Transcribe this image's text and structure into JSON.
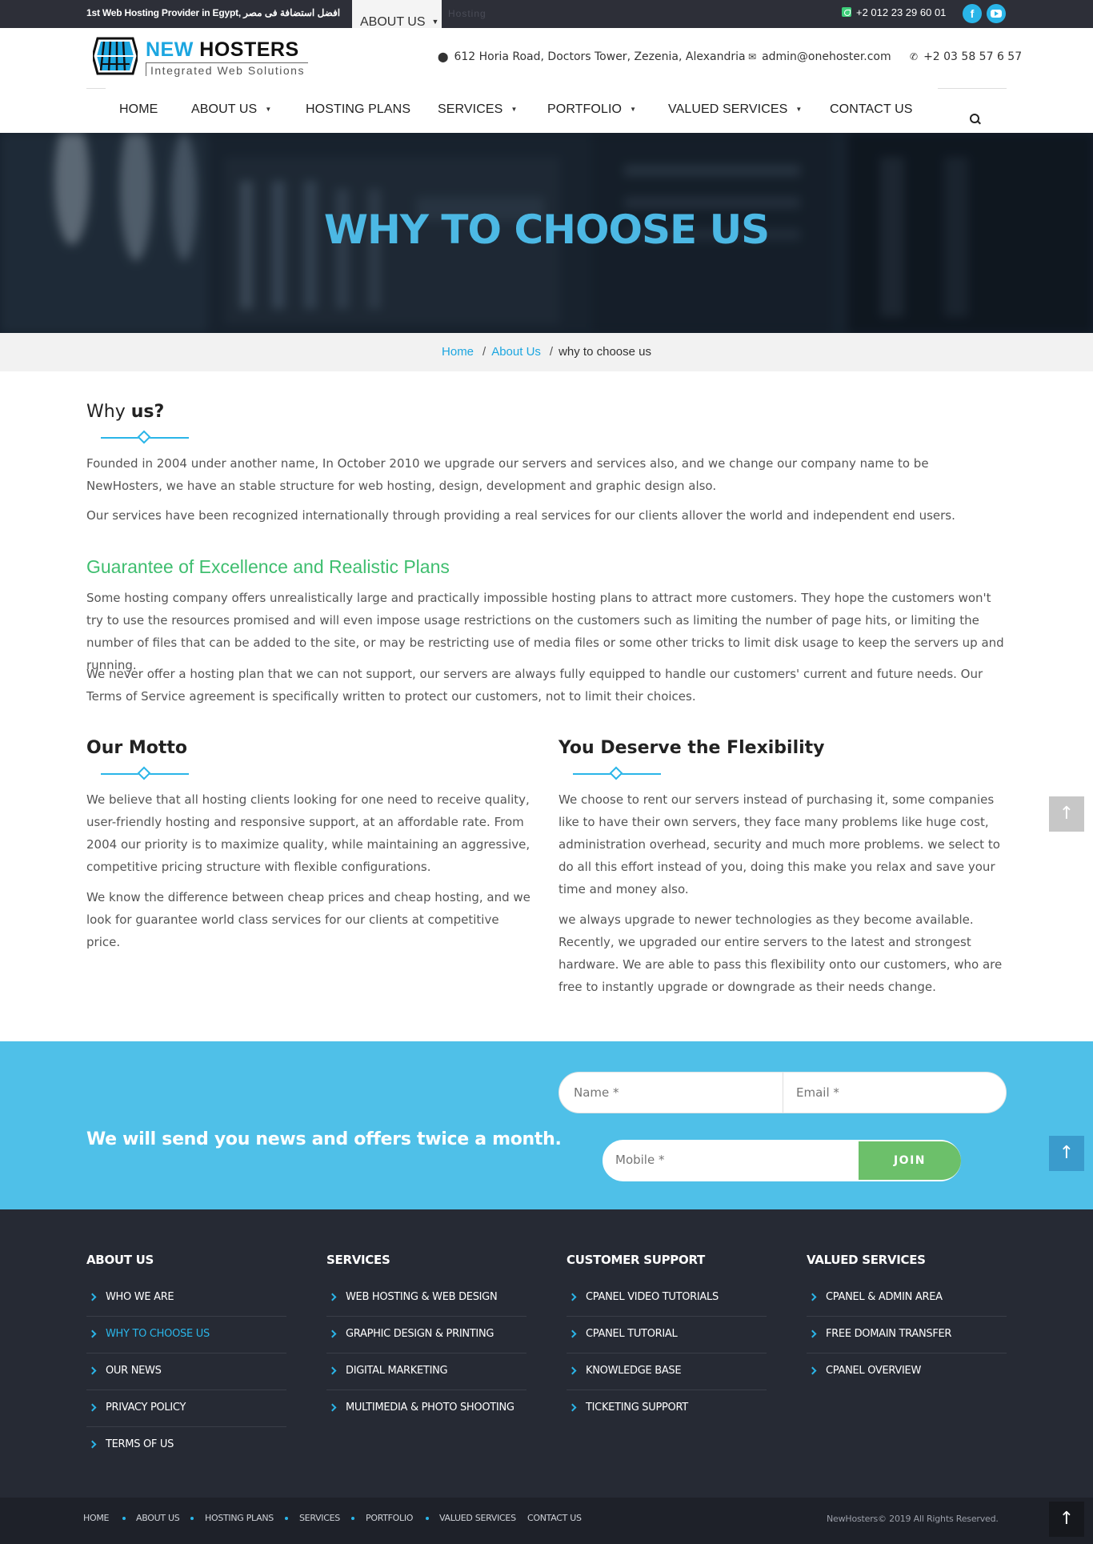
{
  "topbar": {
    "tagline": "1st Web Hosting Provider in Egypt, افضل استضافة فى مصر",
    "ghost_text": "Hosting",
    "dropdown_open": "ABOUT US",
    "phone": "+2 012 23 29 60 01",
    "social": {
      "facebook": "f",
      "youtube": "youtube"
    }
  },
  "logo": {
    "brand_part1": "NEW",
    "brand_part2": "HOSTERS",
    "tagline": "Integrated Web Solutions"
  },
  "contact": {
    "address": "612 Horia Road, Doctors Tower, Zezenia, Alexandria",
    "email": "admin@onehoster.com",
    "phone": "+2 03 58 57 6 57"
  },
  "nav": {
    "items": [
      {
        "label": "HOME",
        "dropdown": false
      },
      {
        "label": "ABOUT US",
        "dropdown": true
      },
      {
        "label": "HOSTING PLANS",
        "dropdown": false
      },
      {
        "label": "SERVICES",
        "dropdown": true
      },
      {
        "label": "PORTFOLIO",
        "dropdown": true
      },
      {
        "label": "VALUED SERVICES",
        "dropdown": true
      },
      {
        "label": "CONTACT US",
        "dropdown": false
      }
    ]
  },
  "hero": {
    "title": "WHY TO CHOOSE US"
  },
  "breadcrumb": {
    "home": "Home",
    "about": "About Us",
    "current": "why to choose us"
  },
  "why": {
    "title_light": "Why ",
    "title_bold": "us?",
    "p1": "Founded in 2004 under another name, In October 2010 we upgrade our servers and services also, and we change our company name to be NewHosters, we have an stable structure for web hosting, design, development and graphic design also.",
    "p2": "Our services have been recognized internationally through providing a real services for our clients allover the world and independent end users."
  },
  "guarantee": {
    "title": "Guarantee of Excellence and Realistic Plans",
    "p1": "Some hosting company offers unrealistically large and practically impossible hosting plans to attract more customers. They hope the customers won't try to use the resources promised and will even impose usage restrictions on the customers such as limiting the number of page hits, or limiting the number of files that can be added to the site, or may be restricting use of media files or some other tricks to limit disk usage to keep the servers up and running.",
    "p2": "We never offer a hosting plan that we can not support, our servers are always fully equipped to handle our customers' current and future needs. Our Terms of Service agreement is specifically written to protect our customers, not to limit their choices."
  },
  "motto": {
    "title": "Our Motto",
    "p1": "We believe that all hosting clients looking for one need to receive quality, user-friendly hosting and responsive support, at an affordable rate. From 2004 our priority is to maximize quality, while maintaining an aggressive, competitive pricing structure with flexible configurations.",
    "p2": "We know the difference between cheap prices and cheap hosting, and we look for guarantee world class services for our clients at competitive price."
  },
  "flex": {
    "title": "You Deserve the Flexibility",
    "p1": "We choose to rent our servers instead of purchasing it, some companies like to have their own servers, they face many problems like huge cost, administration overhead, security and much more problems. we select to do all  this effort instead of you, doing this make you relax and save your time and money also.",
    "p2": "we always upgrade to newer technologies as they become available. Recently, we upgraded our entire servers to the latest and strongest hardware. We are able to pass this flexibility onto our customers, who are free to instantly upgrade or downgrade as their needs change."
  },
  "newsletter": {
    "message": "We will send you news and offers twice a month.",
    "name_placeholder": "Name *",
    "email_placeholder": "Email *",
    "mobile_placeholder": "Mobile *",
    "join_label": "JOIN"
  },
  "footer": {
    "columns": [
      {
        "title": "ABOUT US",
        "items": [
          "WHO WE ARE",
          "WHY TO CHOOSE US",
          "OUR NEWS",
          "PRIVACY POLICY",
          "TERMS OF US"
        ],
        "active": 1
      },
      {
        "title": "SERVICES",
        "items": [
          "WEB HOSTING & WEB DESIGN",
          "GRAPHIC DESIGN & PRINTING",
          "DIGITAL MARKETING",
          "MULTIMEDIA & PHOTO SHOOTING"
        ],
        "active": -1
      },
      {
        "title": "CUSTOMER SUPPORT",
        "items": [
          "CPANEL VIDEO TUTORIALS",
          "CPANEL TUTORIAL",
          "KNOWLEDGE BASE",
          "TICKETING SUPPORT"
        ],
        "active": -1
      },
      {
        "title": "VALUED SERVICES",
        "items": [
          "CPANEL & ADMIN AREA",
          "FREE DOMAIN TRANSFER",
          "CPANEL OVERVIEW"
        ],
        "active": -1
      }
    ]
  },
  "bottom": {
    "links": [
      "HOME",
      "ABOUT US",
      "HOSTING PLANS",
      "SERVICES",
      "PORTFOLIO",
      "VALUED SERVICES",
      "CONTACT US"
    ],
    "copyright": "NewHosters© 2019 All Rights Reserved."
  },
  "colors": {
    "accent": "#2ab5e8",
    "hero_title": "#4cb8e4",
    "green": "#3fbe6f",
    "newsletter_bg": "#4fc0e8",
    "join": "#6cc06a",
    "footer_bg": "#262a34"
  },
  "icons": [
    "phone-icon",
    "facebook-icon",
    "youtube-icon",
    "map-pin-icon",
    "envelope-icon",
    "phone-icon",
    "search-icon",
    "chevron-right-icon",
    "arrow-up-icon"
  ]
}
